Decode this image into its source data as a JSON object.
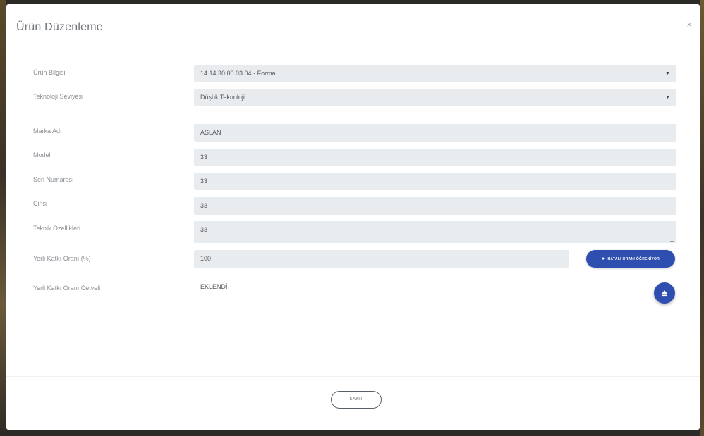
{
  "modal": {
    "title": "Ürün Düzenleme",
    "close_glyph": "×"
  },
  "form": {
    "urun_bilgisi": {
      "label": "Ürün Bilgisi",
      "value": "14.14.30.00.03.04 - Forma",
      "caret": "▼"
    },
    "teknoloji_seviyesi": {
      "label": "Teknoloji Seviyesi",
      "value": "Düşük Teknoloji",
      "caret": "▼"
    },
    "marka_adi": {
      "label": "Marka Adı",
      "value": "ASLAN"
    },
    "model": {
      "label": "Model",
      "value": "33"
    },
    "seri_numarasi": {
      "label": "Seri Numarası",
      "value": "33"
    },
    "cinsi": {
      "label": "Cinsi",
      "value": "33"
    },
    "teknik_ozellikleri": {
      "label": "Teknik Özellikleri",
      "value": "33"
    },
    "yerli_katki_orani": {
      "label": "Yerli Katkı Oranı (%)",
      "value": "100"
    },
    "hesaplama_button": {
      "label": "HATALI ORANI ÖĞRENİYOR",
      "icon": "eye-icon"
    },
    "yerli_katki_orani_cetveli": {
      "label": "Yerli Katkı Oranı Cetveli",
      "value": "EKLENDİ"
    },
    "upload_button": {
      "icon": "upload-icon"
    }
  },
  "footer": {
    "save_label": "KAYIT"
  },
  "colors": {
    "accent": "#2f4fb0",
    "field_bg": "#e9ecef",
    "label": "#8a8f94"
  }
}
